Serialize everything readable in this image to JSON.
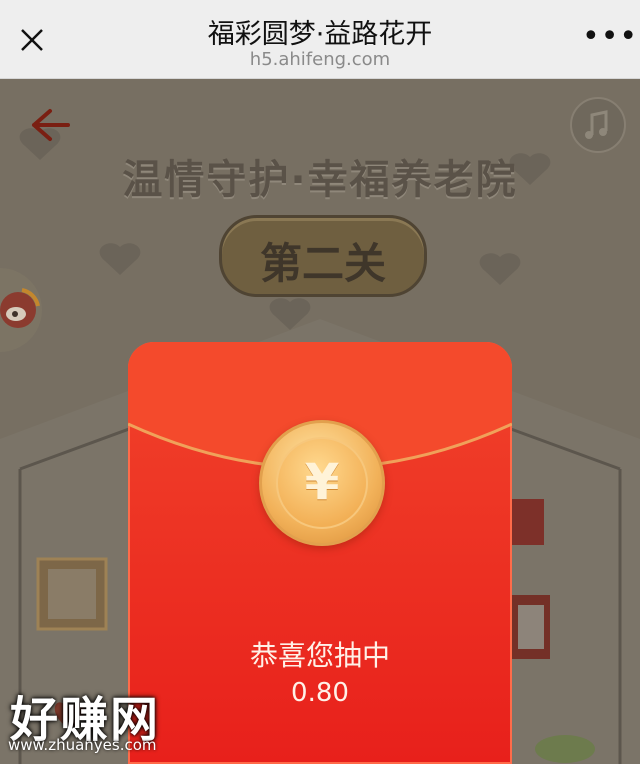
{
  "header": {
    "title": "福彩圆梦·益路花开",
    "url": "h5.ahifeng.com",
    "close_icon": "close-icon",
    "menu_label": "•••"
  },
  "game": {
    "title": "温情守护·幸福养老院",
    "level_label": "第二关",
    "back_icon": "back-arrow-icon",
    "music_icon": "music-icon",
    "weibo_icon": "weibo-icon"
  },
  "red_packet": {
    "coin_symbol": "¥",
    "congrats_text": "恭喜您抽中",
    "amount": "0.80"
  },
  "watermark": {
    "text": "好赚网",
    "url": "www.zhuanyes.com"
  },
  "colors": {
    "envelope_red": "#e8201b",
    "coin_gold": "#f2b25a",
    "overlay_bg": "#776f62"
  }
}
